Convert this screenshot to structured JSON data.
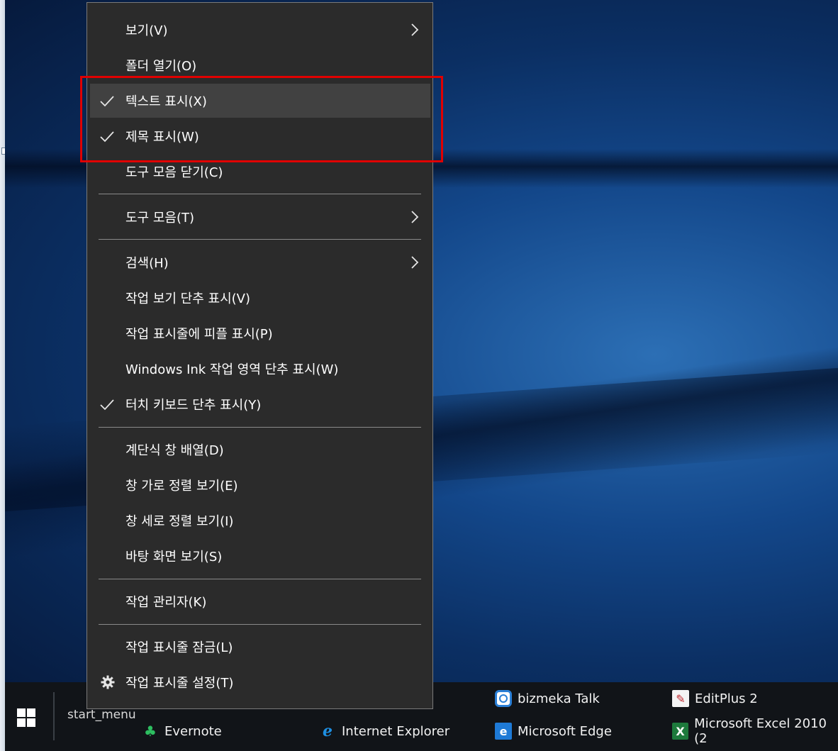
{
  "context_menu": {
    "items": [
      {
        "label": "보기(V)",
        "checked": false,
        "submenu": true
      },
      {
        "label": "폴더 열기(O)",
        "checked": false,
        "submenu": false
      },
      {
        "label": "텍스트 표시(X)",
        "checked": true,
        "submenu": false,
        "hovered": true
      },
      {
        "label": "제목 표시(W)",
        "checked": true,
        "submenu": false
      },
      {
        "label": "도구 모음 닫기(C)",
        "checked": false,
        "submenu": false
      },
      {
        "label": "도구 모음(T)",
        "checked": false,
        "submenu": true
      },
      {
        "label": "검색(H)",
        "checked": false,
        "submenu": true
      },
      {
        "label": "작업 보기 단추 표시(V)",
        "checked": false,
        "submenu": false
      },
      {
        "label": "작업 표시줄에 피플 표시(P)",
        "checked": false,
        "submenu": false
      },
      {
        "label": "Windows Ink 작업 영역 단추 표시(W)",
        "checked": false,
        "submenu": false
      },
      {
        "label": "터치 키보드 단추 표시(Y)",
        "checked": true,
        "submenu": false
      },
      {
        "label": "계단식 창 배열(D)",
        "checked": false,
        "submenu": false
      },
      {
        "label": "창 가로 정렬 보기(E)",
        "checked": false,
        "submenu": false
      },
      {
        "label": "창 세로 정렬 보기(I)",
        "checked": false,
        "submenu": false
      },
      {
        "label": "바탕 화면 보기(S)",
        "checked": false,
        "submenu": false
      },
      {
        "label": "작업 관리자(K)",
        "checked": false,
        "submenu": false
      },
      {
        "label": "작업 표시줄 잠금(L)",
        "checked": false,
        "submenu": false
      },
      {
        "label": "작업 표시줄 설정(T)",
        "checked": false,
        "submenu": false,
        "icon": "gear-icon"
      }
    ]
  },
  "taskbar": {
    "start_menu_label": "start_menu",
    "items": [
      {
        "label": "Evernote",
        "icon": "evernote-icon"
      },
      {
        "label": "Internet Explorer",
        "icon": "internet-explorer-icon"
      },
      {
        "label": "bizmeka Talk",
        "icon": "bizmeka-talk-icon"
      },
      {
        "label": "Microsoft Edge",
        "icon": "microsoft-edge-icon"
      },
      {
        "label": "EditPlus 2",
        "icon": "editplus-icon"
      },
      {
        "label": "Microsoft Excel 2010 (2",
        "icon": "excel-icon"
      }
    ]
  },
  "colors": {
    "menu_background": "#2b2b2b",
    "menu_hover": "#414141",
    "menu_separator": "#8a8a8a",
    "highlight_annotation": "#e00000",
    "taskbar_background": "#111418"
  }
}
